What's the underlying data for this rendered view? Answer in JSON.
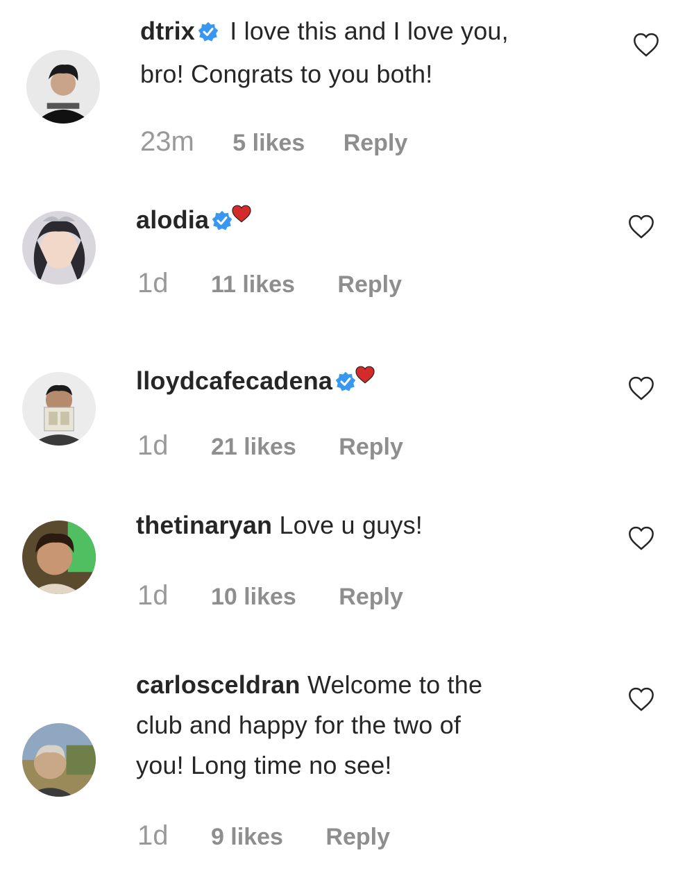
{
  "colors": {
    "verified": "#3897f0",
    "heart": "#ed4956",
    "meta": "#8e8e8e",
    "text": "#262626"
  },
  "comments": [
    {
      "username": "dtrix",
      "verified": true,
      "heart_emoji": false,
      "text_lines": [
        "I love this and I love you,",
        "bro! Congrats to you both!"
      ],
      "time": "23m",
      "likes": "5 likes",
      "reply": "Reply"
    },
    {
      "username": "alodia",
      "verified": true,
      "heart_emoji": true,
      "text_lines": [
        ""
      ],
      "time": "1d",
      "likes": "11 likes",
      "reply": "Reply"
    },
    {
      "username": "lloydcafecadena",
      "verified": true,
      "heart_emoji": true,
      "text_lines": [
        ""
      ],
      "time": "1d",
      "likes": "21 likes",
      "reply": "Reply"
    },
    {
      "username": "thetinaryan",
      "verified": false,
      "heart_emoji": false,
      "text_lines": [
        "Love u guys!"
      ],
      "time": "1d",
      "likes": "10 likes",
      "reply": "Reply"
    },
    {
      "username": "carlosceldran",
      "verified": false,
      "heart_emoji": false,
      "text_lines": [
        "Welcome to the",
        "club and happy for the two of",
        "you! Long time no see!"
      ],
      "time": "1d",
      "likes": "9 likes",
      "reply": "Reply"
    }
  ]
}
